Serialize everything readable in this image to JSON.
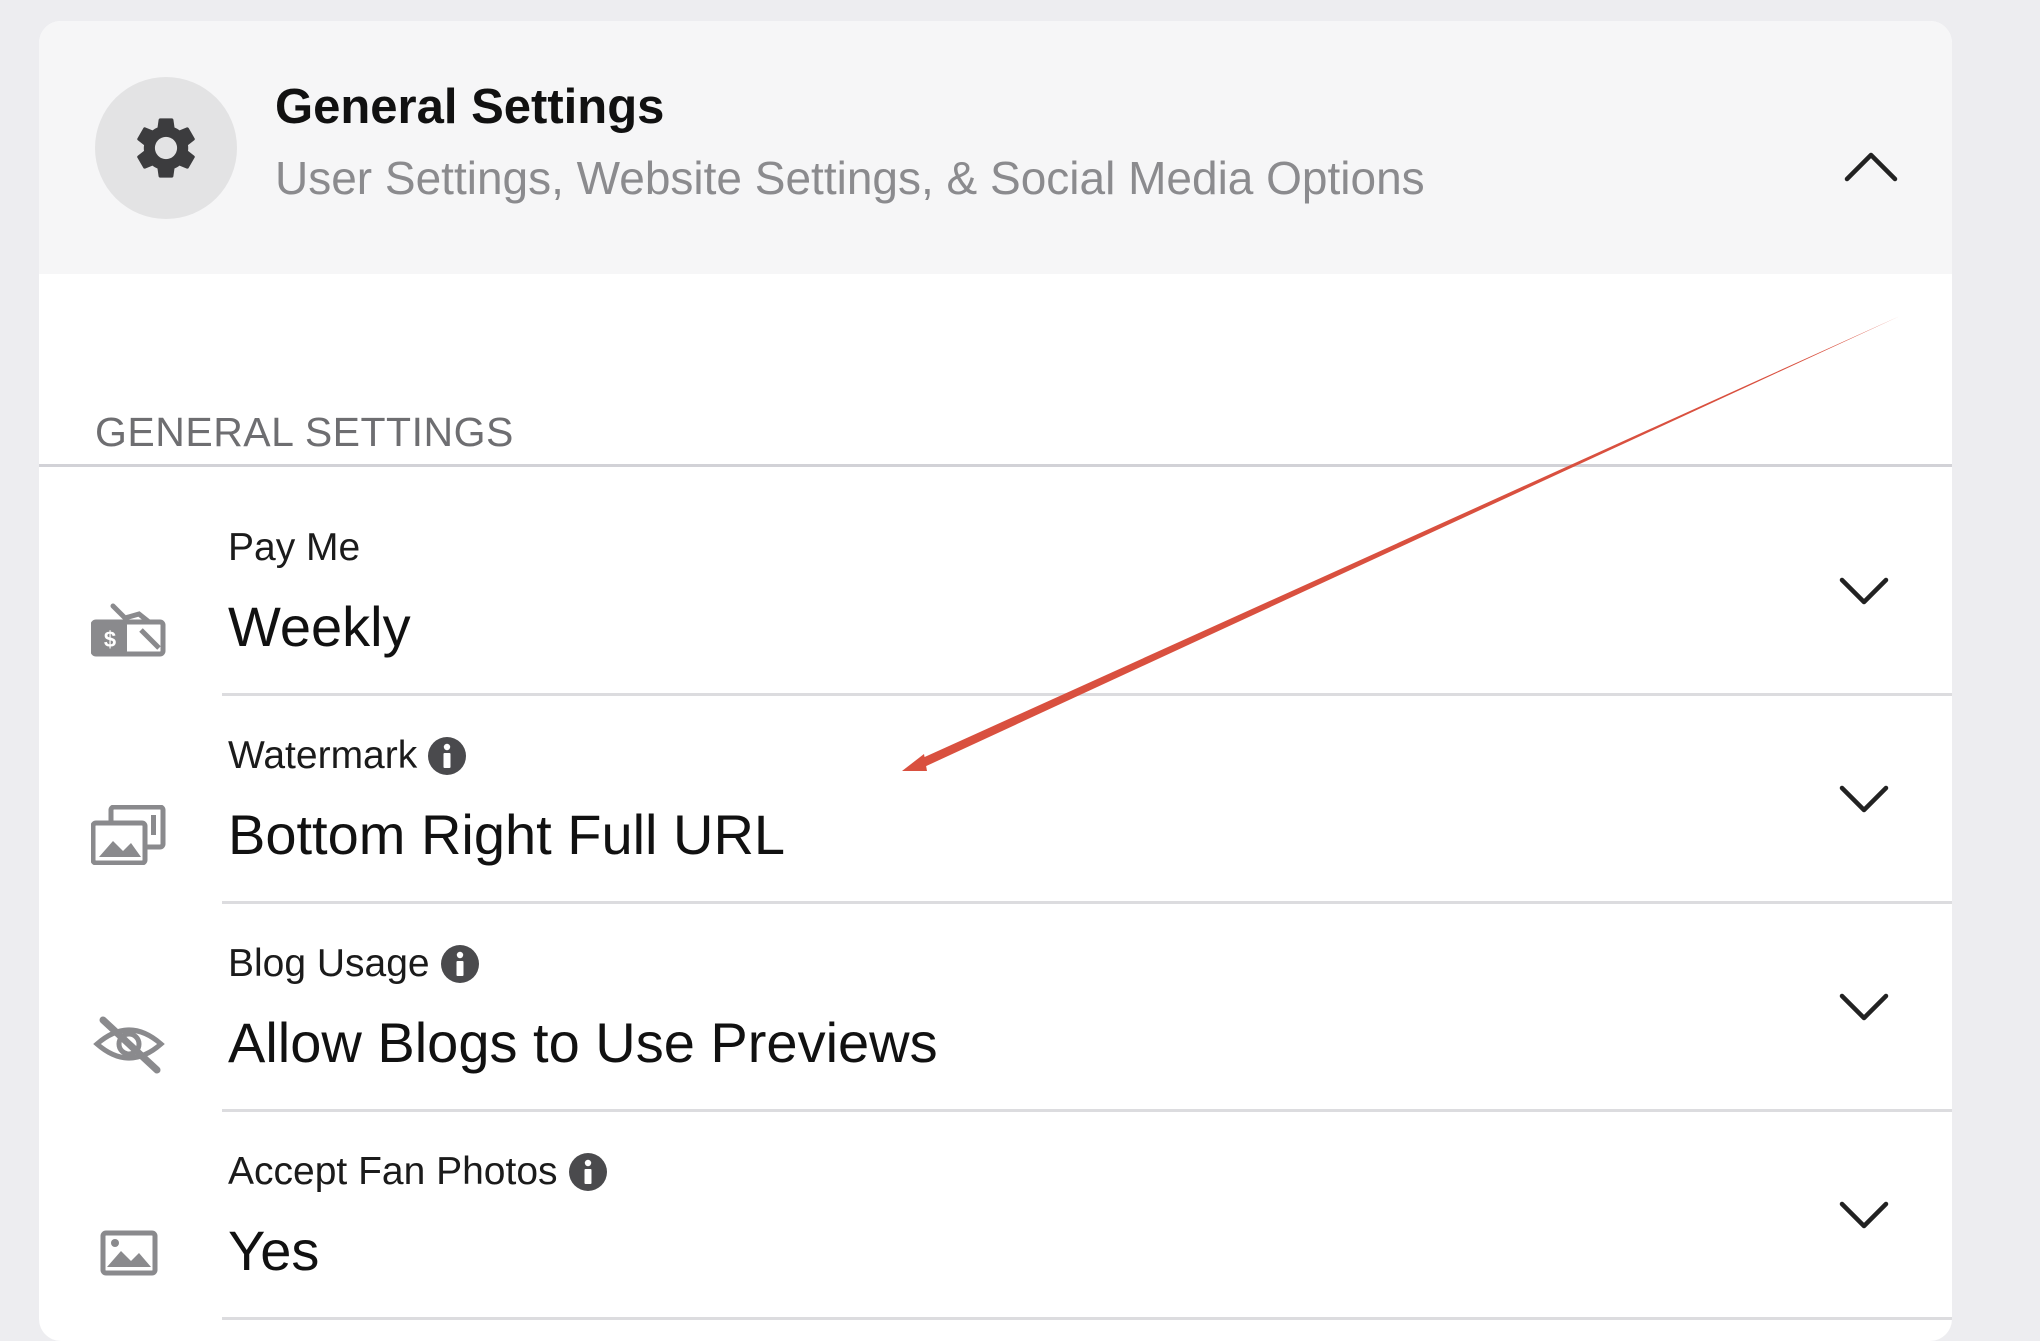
{
  "header": {
    "icon": "gear-icon",
    "title": "General Settings",
    "subtitle": "User Settings, Website Settings, & Social Media Options",
    "toggle_icon": "chevron-up-icon"
  },
  "section": {
    "label": "GENERAL SETTINGS"
  },
  "settings": [
    {
      "icon": "money-hand-icon",
      "label": "Pay Me",
      "value": "Weekly",
      "has_info": false
    },
    {
      "icon": "watermark-images-icon",
      "label": "Watermark",
      "value": "Bottom Right Full URL",
      "has_info": true
    },
    {
      "icon": "eye-slash-icon",
      "label": "Blog Usage",
      "value": "Allow Blogs to Use Previews",
      "has_info": true
    },
    {
      "icon": "image-icon",
      "label": "Accept Fan Photos",
      "value": "Yes",
      "has_info": true
    }
  ],
  "colors": {
    "page_background": "#ededf0",
    "header_background": "#f6f6f7",
    "annotation_arrow": "#d9503f"
  }
}
